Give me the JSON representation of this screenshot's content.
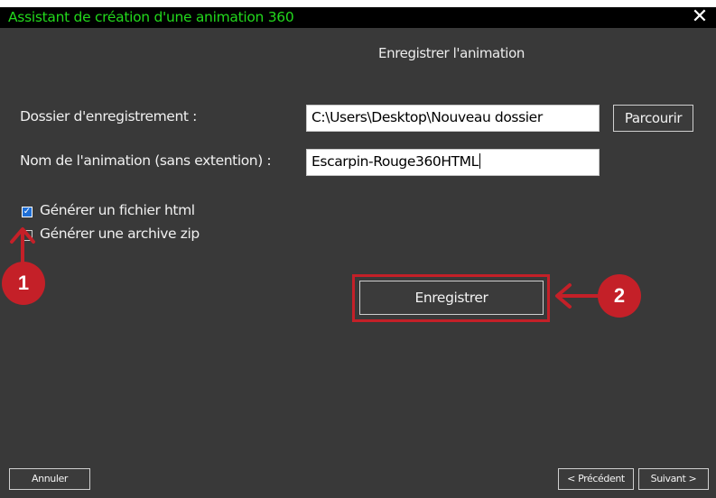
{
  "window": {
    "title": "Assistant de création d'une animation 360",
    "close_label": "✕",
    "subtitle": "Enregistrer l'animation"
  },
  "form": {
    "folder_label": "Dossier d'enregistrement :",
    "folder_value": "C:\\Users\\Desktop\\Nouveau dossier",
    "browse_label": "Parcourir",
    "name_label": "Nom de l'animation (sans extention) :",
    "name_value": "Escarpin-Rouge360HTML",
    "html_checkbox_label": "Générer un fichier html",
    "html_checkbox_checked": true,
    "zip_checkbox_label": "Générer une archive zip",
    "zip_checkbox_checked": false,
    "save_label": "Enregistrer"
  },
  "footer": {
    "cancel_label": "Annuler",
    "previous_label": "< Précédent",
    "next_label": "Suivant >"
  },
  "annotations": {
    "badge1": "1",
    "badge2": "2",
    "color": "#c42028"
  },
  "colors": {
    "title_text": "#22d81c",
    "window_bg": "#393939",
    "titlebar_bg": "#000000"
  }
}
